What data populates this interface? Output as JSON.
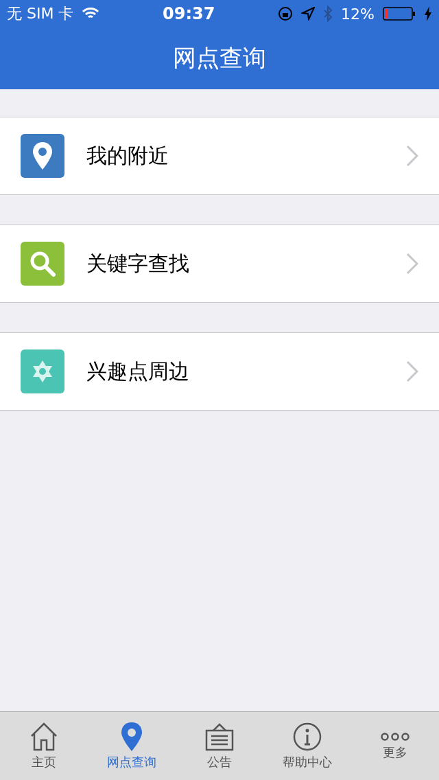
{
  "status_bar": {
    "carrier": "无 SIM 卡",
    "time": "09:37",
    "battery": "12%"
  },
  "nav_bar": {
    "title": "网点查询"
  },
  "menu": [
    {
      "kind": "pin",
      "color": "#3d7bc0",
      "label": "我的附近"
    },
    {
      "kind": "search",
      "color": "#8cbf3a",
      "label": "关键字查找"
    },
    {
      "kind": "star",
      "color": "#4bc4b3",
      "label": "兴趣点周边"
    }
  ],
  "tab_bar": [
    {
      "kind": "home",
      "label": "主页",
      "selected": false
    },
    {
      "kind": "pin",
      "label": "网点查询",
      "selected": true
    },
    {
      "kind": "notice",
      "label": "公告",
      "selected": false
    },
    {
      "kind": "info",
      "label": "帮助中心",
      "selected": false
    },
    {
      "kind": "more",
      "label": "更多",
      "selected": false
    }
  ]
}
